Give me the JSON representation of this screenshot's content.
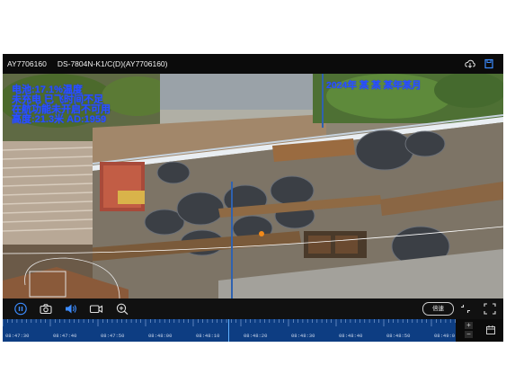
{
  "window": {
    "device_id": "AY7706160",
    "camera_name": "DS-7804N-K1/C(D)(AY7706160)"
  },
  "osd": {
    "left_lines": [
      "电池:17.1%温度",
      "未充电 已飞时间不足",
      "在航功能未开启不可用",
      "高度:21.3米 AD:1959"
    ],
    "right_text": "2024年 某 某 某年某月"
  },
  "icons": {
    "cloud": "cloud-download-icon",
    "save": "save-icon",
    "pause": "pause-icon",
    "snapshot": "camera-icon",
    "volume": "volume-icon",
    "record": "video-record-icon",
    "zoom": "zoom-in-icon",
    "speed": "倍速",
    "fullscreen_shrink": "shrink-icon",
    "fullscreen": "fullscreen-icon"
  },
  "timeline": {
    "ticks": [
      "08:47:30",
      "08:47:40",
      "08:47:50",
      "08:48:00",
      "08:48:10",
      "08:48:20",
      "08:48:30",
      "08:48:40",
      "08:48:50",
      "08:49:0"
    ],
    "zoom_in": "+",
    "zoom_out": "−"
  },
  "colors": {
    "osd_text": "#2a52ff",
    "timeline_bg": "#0e3f86",
    "cursor": "#5fb0ff"
  }
}
